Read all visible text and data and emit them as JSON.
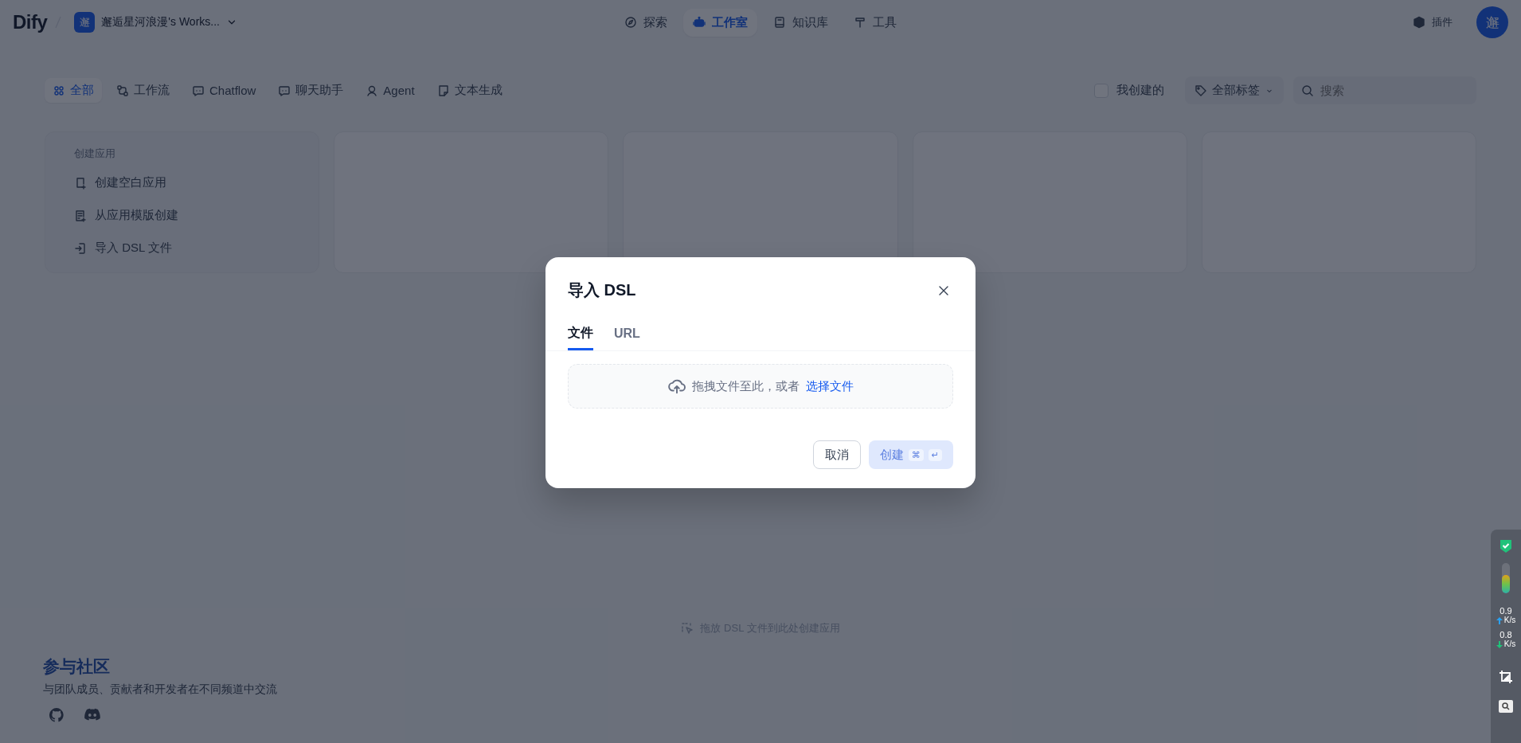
{
  "header": {
    "logo": "Dify",
    "workspace": {
      "avatar": "邂",
      "name": "邂逅星河浪漫's Works..."
    },
    "nav": [
      {
        "label": "探索",
        "selected": false
      },
      {
        "label": "工作室",
        "selected": true
      },
      {
        "label": "知识库",
        "selected": false
      },
      {
        "label": "工具",
        "selected": false
      }
    ],
    "plugins": "插件",
    "user_avatar": "邂"
  },
  "filters": {
    "tabs": [
      {
        "label": "全部",
        "selected": true
      },
      {
        "label": "工作流",
        "selected": false
      },
      {
        "label": "Chatflow",
        "selected": false
      },
      {
        "label": "聊天助手",
        "selected": false
      },
      {
        "label": "Agent",
        "selected": false
      },
      {
        "label": "文本生成",
        "selected": false
      }
    ],
    "mine": {
      "label": "我创建的",
      "checked": false
    },
    "tags": "全部标签",
    "search": {
      "placeholder": "搜索"
    }
  },
  "create_card": {
    "title": "创建应用",
    "actions": [
      "创建空白应用",
      "从应用模版创建",
      "导入 DSL 文件"
    ]
  },
  "drop_hint": "拖放 DSL 文件到此处创建应用",
  "community": {
    "title": "参与社区",
    "subtitle": "与团队成员、贡献者和开发者在不同频道中交流"
  },
  "dialog": {
    "title": "导入 DSL",
    "tabs": [
      {
        "label": "文件",
        "selected": true
      },
      {
        "label": "URL",
        "selected": false
      }
    ],
    "dropzone": {
      "text": "拖拽文件至此，或者",
      "link": "选择文件"
    },
    "cancel": "取消",
    "create": {
      "label": "创建",
      "disabled": true,
      "keys": [
        "⌘",
        "↵"
      ]
    }
  },
  "monitor": {
    "meter": {
      "level": 0.6
    },
    "upload": {
      "value": "0.9",
      "unit": "K/s"
    },
    "download": {
      "value": "0.8",
      "unit": "K/s"
    }
  }
}
